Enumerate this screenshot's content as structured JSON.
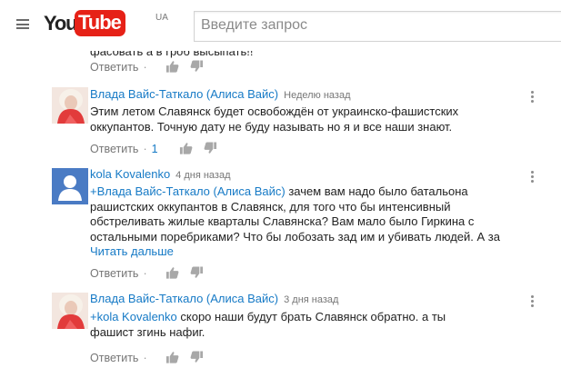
{
  "header": {
    "logo_you": "You",
    "logo_tube": "Tube",
    "logo_region": "UA",
    "search_placeholder": "Введите запрос"
  },
  "colors": {
    "link": "#167ac6",
    "brand_red": "#e62117",
    "muted": "#767676"
  },
  "comments": [
    {
      "partial_text": "фасовать а в гроб высыпать!!",
      "reply_label": "Ответить",
      "icons": [
        "thumbs-up-icon",
        "thumbs-down-icon"
      ]
    },
    {
      "author": "Влада Вайс-Таткало (Алиса Вайс)",
      "time": "Неделю назад",
      "text": "Этим летом Славянск будет освобождён от украинско-фашистских оккупантов. Точную дату не буду называть но я и все наши знают.",
      "reply_label": "Ответить",
      "reply_count": "1",
      "icons": [
        "thumbs-up-icon",
        "thumbs-down-icon",
        "more-vert-icon"
      ]
    },
    {
      "author": "kola Kovalenko",
      "time": "4 дня назад",
      "mention": "+Влада Вайс-Таткало (Алиса Вайс)",
      "text": " зачем вам надо было батальона рашистских оккупантов в Славянск, для того что бы интенсивный обстреливать жилые кварталы Славянска? Вам мало было Гиркина с остальными поребриками? Что бы лобозать зад им и убивать людей. А за",
      "read_more": "Читать дальше",
      "reply_label": "Ответить",
      "icons": [
        "default-avatar-icon",
        "thumbs-up-icon",
        "thumbs-down-icon",
        "more-vert-icon"
      ]
    },
    {
      "author": "Влада Вайс-Таткало (Алиса Вайс)",
      "time": "3 дня назад",
      "mention": "+kola Kovalenko",
      "text": " скоро наши будут брать Славянск обратно. а ты фашист згинь нафиг.",
      "reply_label": "Ответить",
      "icons": [
        "thumbs-up-icon",
        "thumbs-down-icon",
        "more-vert-icon"
      ]
    }
  ]
}
